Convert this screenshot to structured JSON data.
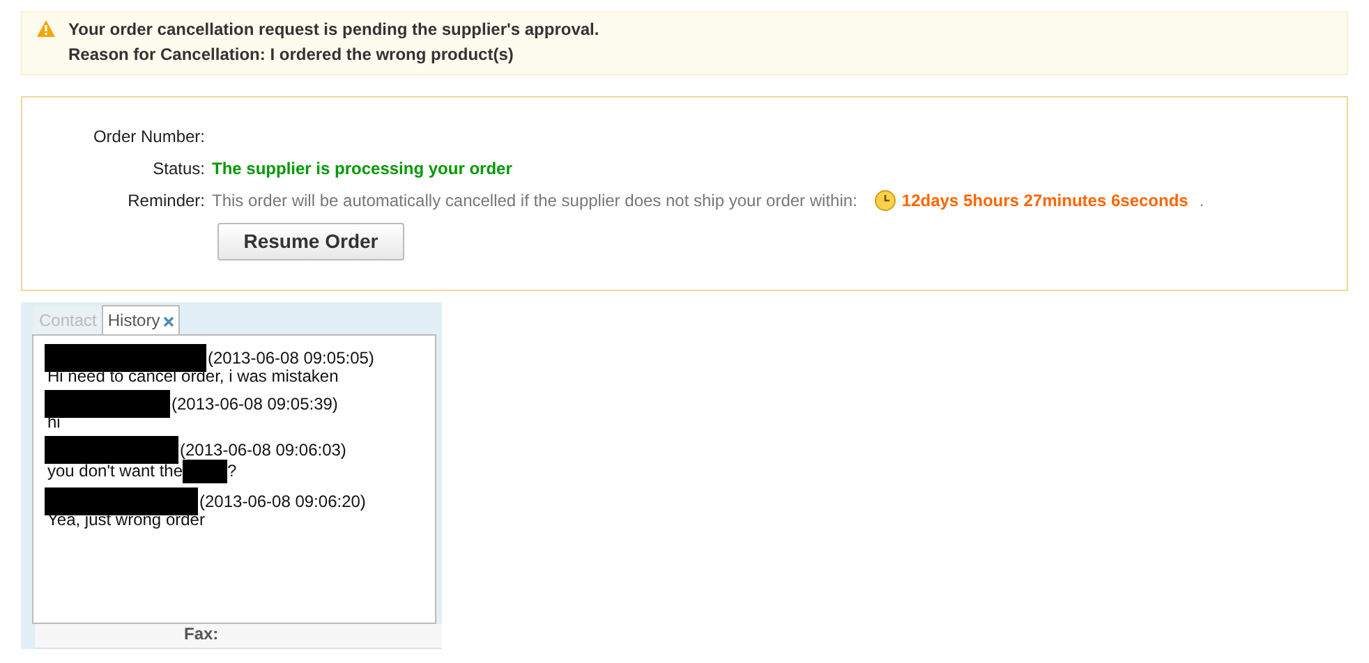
{
  "notice": {
    "title": "Your order cancellation request is pending the supplier's approval.",
    "reason": "Reason for Cancellation: I ordered the wrong product(s)"
  },
  "order": {
    "fields": [
      {
        "kind": "plain",
        "label": "Order Number:"
      },
      {
        "kind": "status",
        "label": "Status:",
        "value": "The supplier is processing your order"
      },
      {
        "kind": "reminder",
        "label": "Reminder:",
        "value": "This order will be automatically cancelled if the supplier does not ship your order within:",
        "countdown": "12days 5hours 27minutes 6seconds",
        "end": "."
      }
    ],
    "button": "Resume Order"
  },
  "chat": {
    "tabs": [
      {
        "label": "Contact",
        "selected": false,
        "closable": false
      },
      {
        "label": "History",
        "selected": true,
        "closable": true
      }
    ],
    "messages": [
      {
        "time": "(2013-06-08 09:05:05)",
        "text": "Hi need to cancel order, i was mistaken"
      },
      {
        "time": "(2013-06-08 09:05:39)",
        "text": "hi"
      },
      {
        "time": "(2013-06-08 09:06:03)",
        "text": "you don't want the",
        "text_after": "?"
      },
      {
        "time": "(2013-06-08 09:06:20)",
        "text": "Yea, just wrong order"
      }
    ],
    "footer_label": "Fax:"
  }
}
